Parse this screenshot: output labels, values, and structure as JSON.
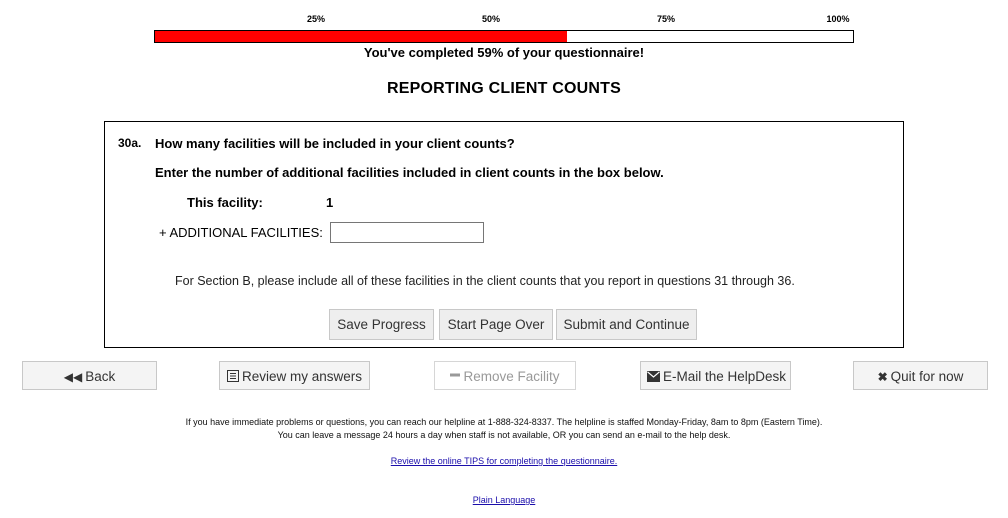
{
  "progress": {
    "ticks": [
      "25%",
      "50%",
      "75%",
      "100%"
    ],
    "percent": 59,
    "text": "You've completed 59% of your questionnaire!",
    "fill_color": "#ff0000"
  },
  "section_title": "REPORTING CLIENT COUNTS",
  "question": {
    "number": "30a.",
    "text": "How many facilities will be included in your client counts?",
    "instruction": "Enter the number of additional facilities included in client counts in the box below.",
    "this_facility_label": "This facility:",
    "this_facility_value": "1",
    "additional_label": "+ ADDITIONAL FACILITIES:",
    "additional_value": "",
    "section_note": "For Section B, please include all of these facilities in the client counts that you report in questions 31 through 36."
  },
  "form_buttons": {
    "save": "Save Progress",
    "start_over": "Start Page Over",
    "submit": "Submit and Continue"
  },
  "nav": {
    "back": {
      "label": "Back",
      "icon": "double-left-arrow-icon"
    },
    "review": {
      "label": "Review my answers",
      "icon": "list-icon"
    },
    "remove": {
      "label": "Remove Facility",
      "icon": "minus-icon"
    },
    "email": {
      "label": "E-Mail the HelpDesk",
      "icon": "envelope-icon"
    },
    "quit": {
      "label": "Quit for now",
      "icon": "close-icon"
    }
  },
  "footer": {
    "line1": "If you have immediate problems or questions, you can reach our helpline at 1-888-324-8337. The helpline is staffed Monday-Friday, 8am to 8pm (Eastern Time).",
    "line2": "You can leave a message 24 hours a day when staff is not available, OR you can send an e-mail to the help desk.",
    "tips_link": "Review the online TIPS for completing the questionnaire.",
    "plain_language_link": "Plain Language"
  }
}
